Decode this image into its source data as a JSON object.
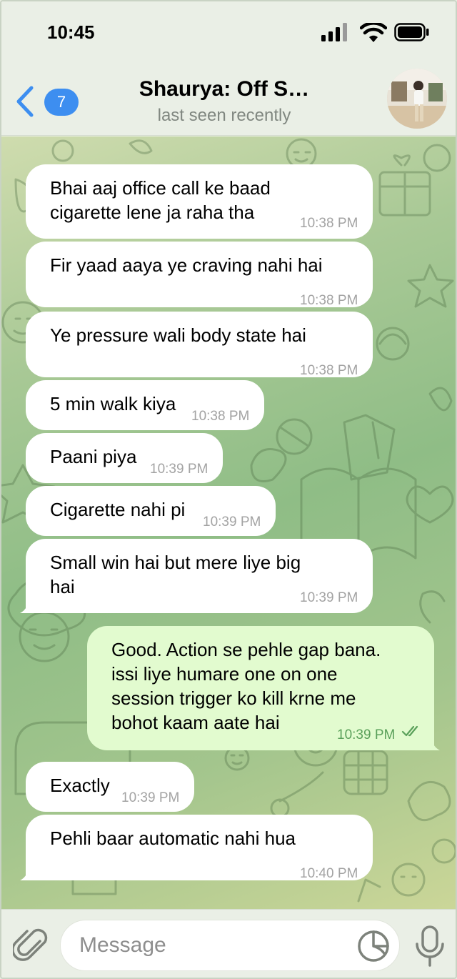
{
  "status_bar": {
    "time": "10:45",
    "icons": [
      "signal-icon",
      "wifi-icon",
      "battery-icon"
    ]
  },
  "header": {
    "unread_count": "7",
    "title": "Shaurya: Off S…",
    "subtitle": "last seen recently"
  },
  "messages": [
    {
      "direction": "in",
      "lines": [
        "Bhai aaj office call ke baad",
        "cigarette lene ja raha tha"
      ],
      "time": "10:38 PM"
    },
    {
      "direction": "in",
      "lines": [
        "Fir yaad aaya ye craving nahi hai"
      ],
      "time": "10:38 PM"
    },
    {
      "direction": "in",
      "lines": [
        "Ye pressure wali body state hai"
      ],
      "time": "10:38 PM"
    },
    {
      "direction": "in",
      "lines": [
        "5 min walk kiya"
      ],
      "time": "10:38 PM"
    },
    {
      "direction": "in",
      "lines": [
        "Paani piya"
      ],
      "time": "10:39 PM"
    },
    {
      "direction": "in",
      "lines": [
        "Cigarette nahi pi"
      ],
      "time": "10:39 PM"
    },
    {
      "direction": "in",
      "lines": [
        "Small win hai but mere liye big",
        "hai"
      ],
      "time": "10:39 PM"
    },
    {
      "direction": "out",
      "lines": [
        "Good. Action se pehle gap bana.",
        "issi liye humare one on one",
        "session trigger ko kill krne me",
        "bohot kaam aate hai"
      ],
      "time": "10:39 PM",
      "status": "read"
    },
    {
      "direction": "in",
      "lines": [
        "Exactly"
      ],
      "time": "10:39 PM"
    },
    {
      "direction": "in",
      "lines": [
        "Pehli baar automatic nahi hua"
      ],
      "time": "10:40 PM"
    }
  ],
  "composer": {
    "placeholder": "Message",
    "value": ""
  },
  "colors": {
    "accent": "#3d8ef0",
    "incoming_bubble": "#ffffff",
    "outgoing_bubble": "#e2fbcf",
    "outgoing_time": "#5aa05a",
    "chat_bg": "#a3c58d"
  }
}
